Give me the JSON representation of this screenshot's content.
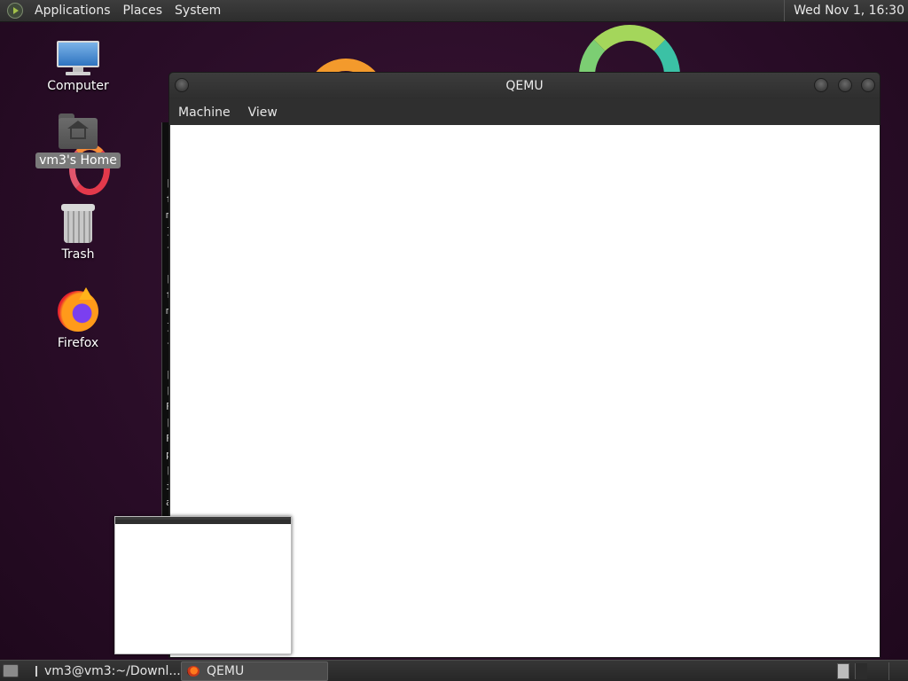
{
  "top_panel": {
    "menus": [
      "Applications",
      "Places",
      "System"
    ],
    "clock": "Wed Nov 1, 16:30"
  },
  "desktop": {
    "icons": [
      {
        "label": "Computer",
        "icon": "computer-icon"
      },
      {
        "label": "vm3's Home",
        "icon": "home-folder-icon",
        "selected": true
      },
      {
        "label": "Trash",
        "icon": "trash-icon"
      },
      {
        "label": "Firefox",
        "icon": "firefox-icon"
      }
    ]
  },
  "terminal_bg": {
    "lines": [
      "[",
      "f",
      "m",
      "]",
      "-",
      "[",
      "f",
      "m",
      "]",
      "-",
      "[",
      "[",
      "F",
      "[",
      "F",
      "p",
      "[",
      "i",
      "a"
    ]
  },
  "qemu": {
    "title": "QEMU",
    "menus": [
      "Machine",
      "View"
    ]
  },
  "taskbar": {
    "tasks": [
      {
        "label": "vm3@vm3:~/Downl...",
        "icon": "terminal-icon",
        "active": false
      },
      {
        "label": "QEMU",
        "icon": "qemu-icon",
        "active": true
      }
    ]
  },
  "colors": {
    "panel": "#2d2d2d",
    "wallpaper": "#2a0d28",
    "display": "#ffffff"
  }
}
